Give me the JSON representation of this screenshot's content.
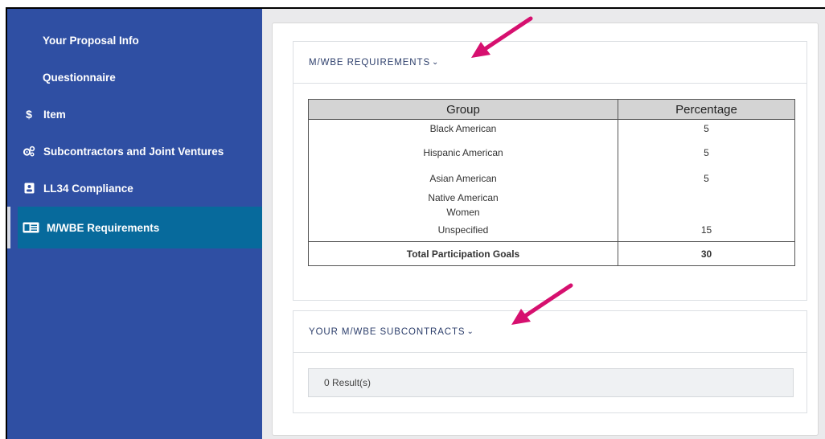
{
  "sidebar": {
    "items": [
      {
        "label": "Your Proposal Info",
        "icon": null
      },
      {
        "label": "Questionnaire",
        "icon": null
      },
      {
        "label": "Item",
        "icon": "dollar-icon"
      },
      {
        "label": "Subcontractors and Joint Ventures",
        "icon": "gears-icon"
      },
      {
        "label": "LL34 Compliance",
        "icon": "badge-icon"
      },
      {
        "label": "M/WBE Requirements",
        "icon": "id-card-icon",
        "active": true
      }
    ]
  },
  "requirements_panel": {
    "title": "M/WBE REQUIREMENTS",
    "chevron": "⌄",
    "table": {
      "headers": [
        "Group",
        "Percentage"
      ],
      "rows": [
        {
          "group": "Black American",
          "percentage": "5"
        },
        {
          "group": "Hispanic American",
          "percentage": "5"
        },
        {
          "group": "Asian American",
          "percentage": "5"
        },
        {
          "group": "Native American",
          "percentage": ""
        },
        {
          "group": "Women",
          "percentage": ""
        },
        {
          "group": "Unspecified",
          "percentage": "15"
        }
      ],
      "total": {
        "label": "Total Participation Goals",
        "value": "30"
      }
    }
  },
  "subcontracts_panel": {
    "title": "YOUR M/WBE SUBCONTRACTS",
    "chevron": "⌄",
    "results_text": "0 Result(s)"
  },
  "colors": {
    "sidebar_bg": "#2f4fa3",
    "active_item_bg": "#076a9c",
    "annotation_arrow": "#d6106f"
  }
}
